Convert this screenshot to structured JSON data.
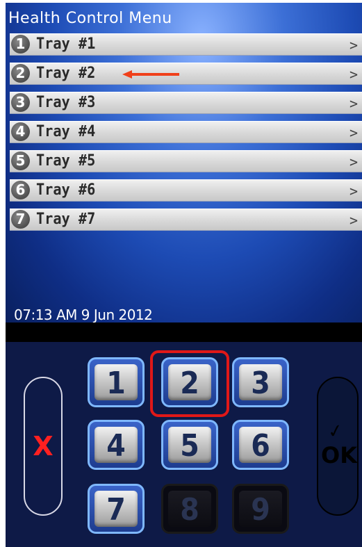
{
  "screen": {
    "title": "Health Control Menu",
    "datetime": "07:13 AM 9 Jun 2012",
    "trays": [
      {
        "num": "1",
        "label": "Tray #1",
        "chevron": ">"
      },
      {
        "num": "2",
        "label": "Tray #2",
        "chevron": ">"
      },
      {
        "num": "3",
        "label": "Tray #3",
        "chevron": ">"
      },
      {
        "num": "4",
        "label": "Tray #4",
        "chevron": ">"
      },
      {
        "num": "5",
        "label": "Tray #5",
        "chevron": ">"
      },
      {
        "num": "6",
        "label": "Tray #6",
        "chevron": ">"
      },
      {
        "num": "7",
        "label": "Tray #7",
        "chevron": ">"
      }
    ]
  },
  "keypad": {
    "cancel_label": "X",
    "ok_check": "✓",
    "ok_label": "OK",
    "keys": [
      {
        "label": "1",
        "enabled": true
      },
      {
        "label": "2",
        "enabled": true
      },
      {
        "label": "3",
        "enabled": true
      },
      {
        "label": "4",
        "enabled": true
      },
      {
        "label": "5",
        "enabled": true
      },
      {
        "label": "6",
        "enabled": true
      },
      {
        "label": "7",
        "enabled": true
      },
      {
        "label": "8",
        "enabled": false
      },
      {
        "label": "9",
        "enabled": false
      }
    ]
  },
  "colors": {
    "annotation_arrow": "#f0401a",
    "annotation_box": "#e01818",
    "cancel_x": "#ff2020"
  }
}
